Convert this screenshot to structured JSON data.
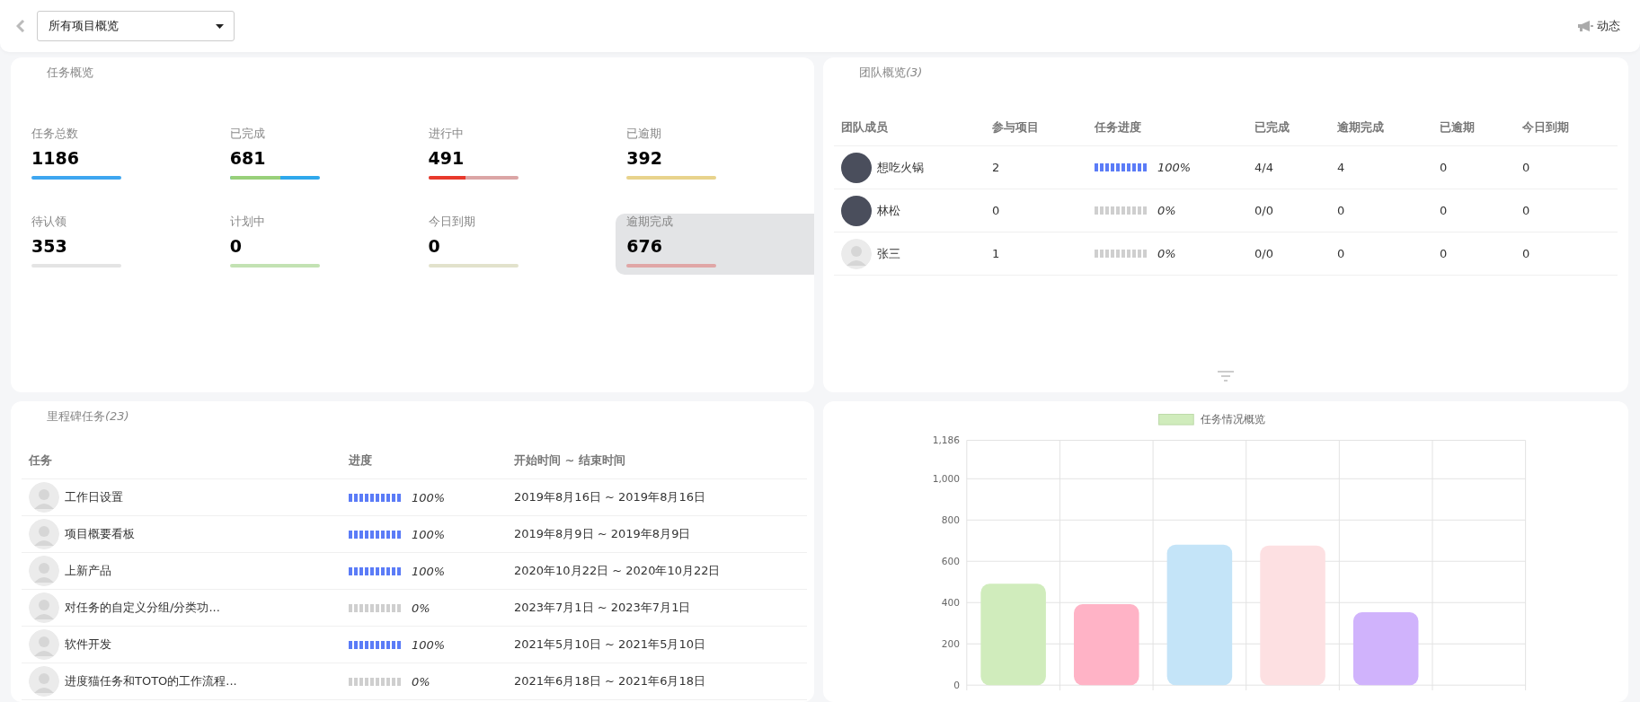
{
  "header": {
    "project_select": "所有项目概览",
    "activity": "动态"
  },
  "task_overview": {
    "title": "任务概览",
    "stats": [
      {
        "label": "任务总数",
        "value": "1186",
        "color": "#3ea6f0",
        "selected": false
      },
      {
        "label": "已完成",
        "value": "681",
        "color": "#2fa8ec",
        "fill": {
          "level": 0.56,
          "color": "#98d07a"
        },
        "selected": false
      },
      {
        "label": "进行中",
        "value": "491",
        "color": "#dba5a5",
        "fill": {
          "level": 0.41,
          "color": "#e8392c"
        },
        "selected": false
      },
      {
        "label": "已逾期",
        "value": "392",
        "color": "#e8d38c",
        "selected": false
      },
      {
        "label": "待认领",
        "value": "353",
        "color": "#e4e4e4",
        "selected": false
      },
      {
        "label": "计划中",
        "value": "0",
        "color": "#c3e2b3",
        "selected": false
      },
      {
        "label": "今日到期",
        "value": "0",
        "color": "#e2e2cc",
        "selected": false
      },
      {
        "label": "逾期完成",
        "value": "676",
        "color": "#e0a6a6",
        "selected": true
      }
    ]
  },
  "team_overview": {
    "title": "团队概览",
    "count": "(3)",
    "columns": [
      "团队成员",
      "参与项目",
      "任务进度",
      "已完成",
      "逾期完成",
      "已逾期",
      "今日到期"
    ],
    "rows": [
      {
        "kind": "photo",
        "name": "想吃火锅",
        "projects": "2",
        "level": 1,
        "percent": "100%",
        "done": "4/4",
        "overdue_done": "4",
        "overdue": "0",
        "due_today": "0"
      },
      {
        "kind": "photo",
        "name": "林松",
        "projects": "0",
        "level": 0,
        "percent": "0%",
        "done": "0/0",
        "overdue_done": "0",
        "overdue": "0",
        "due_today": "0"
      },
      {
        "kind": "default",
        "name": "张三",
        "projects": "1",
        "level": 0,
        "percent": "0%",
        "done": "0/0",
        "overdue_done": "0",
        "overdue": "0",
        "due_today": "0"
      }
    ]
  },
  "milestones": {
    "title": "里程碑任务",
    "count": "(23)",
    "columns": [
      "任务",
      "进度",
      "开始时间 ~ 结束时间"
    ],
    "rows": [
      {
        "name": "工作日设置",
        "level": 1,
        "percent": "100%",
        "dates": "2019年8月16日 ~ 2019年8月16日"
      },
      {
        "name": "项目概要看板",
        "level": 1,
        "percent": "100%",
        "dates": "2019年8月9日 ~ 2019年8月9日"
      },
      {
        "name": "上新产品",
        "level": 1,
        "percent": "100%",
        "dates": "2020年10月22日 ~ 2020年10月22日"
      },
      {
        "name": "对任务的自定义分组/分类功...",
        "level": 0,
        "percent": "0%",
        "dates": "2023年7月1日 ~ 2023年7月1日"
      },
      {
        "name": "软件开发",
        "level": 1,
        "percent": "100%",
        "dates": "2021年5月10日 ~ 2021年5月10日"
      },
      {
        "name": "进度猫任务和TOTO的工作流程...",
        "level": 0,
        "percent": "0%",
        "dates": "2021年6月18日 ~ 2021年6月18日"
      }
    ]
  },
  "chart_panel": {
    "chart_data": {
      "type": "bar",
      "series": [
        {
          "name": "任务情况概览",
          "color": "#d0ecbc",
          "colors": [
            "#d0ecbc",
            "#ffb3c6",
            "#c4e4f8",
            "#fde0e2",
            "#d0b3fc",
            null
          ],
          "values": [
            491,
            392,
            681,
            676,
            353,
            null
          ]
        }
      ],
      "grid": true,
      "ylim": [
        0,
        1186
      ],
      "yticks": [
        0,
        200,
        400,
        600,
        800,
        {
          "value": 1000,
          "label": "1,000"
        },
        {
          "value": 1186,
          "label": "1,186"
        }
      ]
    }
  }
}
